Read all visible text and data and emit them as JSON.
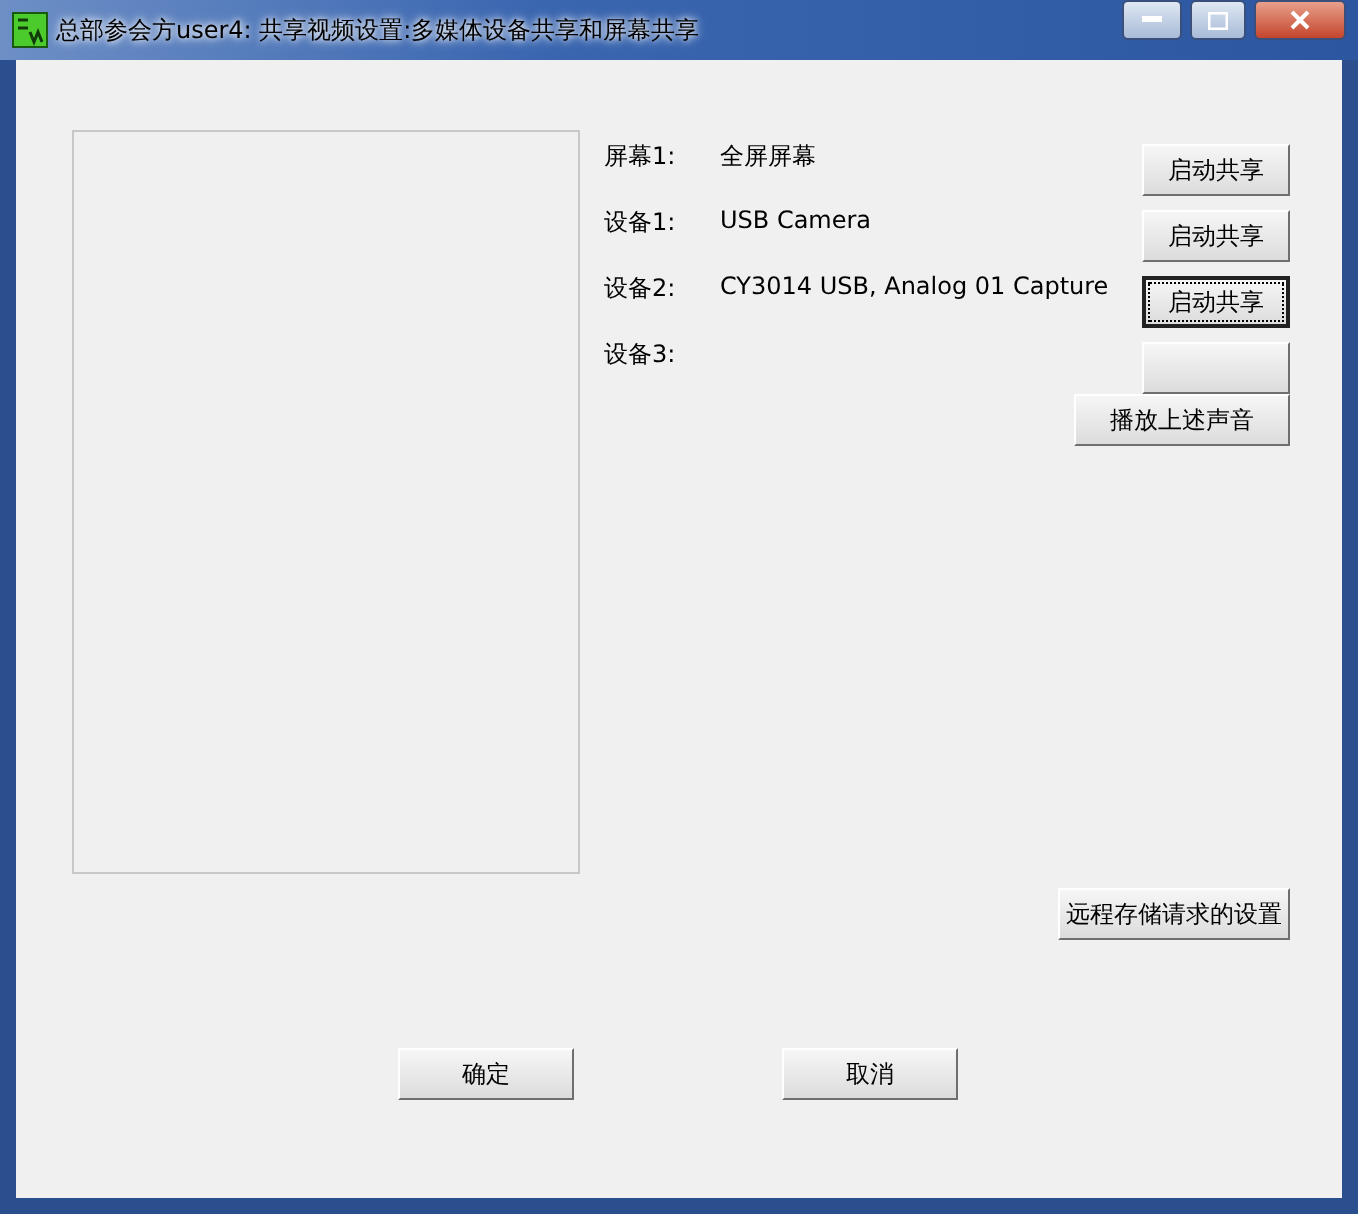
{
  "window": {
    "title": "总部参会方user4: 共享视频设置:多媒体设备共享和屏幕共享"
  },
  "rows": [
    {
      "label": "屏幕1:",
      "value": "全屏屏幕",
      "button": {
        "label": "启动共享",
        "focused": false
      }
    },
    {
      "label": "设备1:",
      "value": "USB Camera",
      "button": {
        "label": "启动共享",
        "focused": false
      }
    },
    {
      "label": "设备2:",
      "value": "CY3014 USB, Analog 01 Capture",
      "button": {
        "label": "启动共享",
        "focused": true
      }
    },
    {
      "label": "设备3:",
      "button": {
        "focused": false
      }
    }
  ],
  "play_button": "播放上述声音",
  "remote_button": "远程存储请求的设置",
  "ok_button": "确定",
  "cancel_button": "取消"
}
